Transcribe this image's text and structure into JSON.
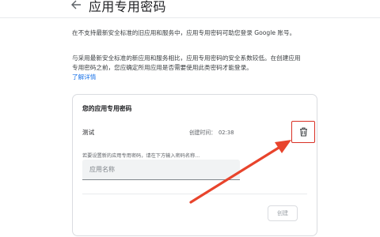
{
  "header": {
    "title": "应用专用密码"
  },
  "intro": {
    "p1": "在不支持最新安全标准的旧应用和服务中，应用专用密码可助您登录 Google 账号。",
    "p2": "与采用最新安全标准的新应用和服务相比，应用专用密码的安全系数较低。在创建应用专用密码之前，您应确定所用应用是否需要使用此类密码才能登录。",
    "learn_more": "了解详情"
  },
  "card": {
    "title": "您的应用专用密码",
    "password": {
      "name": "测试",
      "created_label": "创建时间：",
      "created_time": "02:38"
    },
    "instruction": "若要设置新的应用专用密码，请在下方输入密码名称...",
    "app_name_placeholder": "应用名称",
    "create_label": "创建"
  },
  "icons": {
    "back": "arrow-left-icon",
    "delete": "trash-icon"
  },
  "colors": {
    "annotation": "#e8442c",
    "link": "#1a73e8"
  }
}
